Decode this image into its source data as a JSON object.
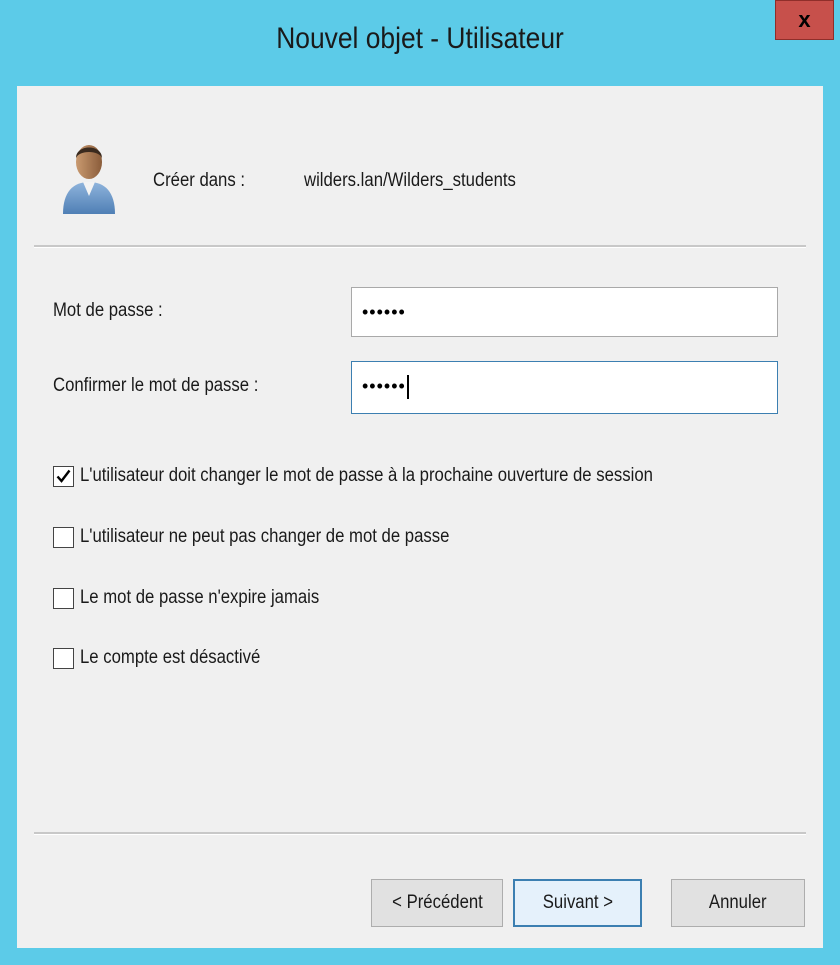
{
  "window": {
    "title": "Nouvel objet - Utilisateur",
    "close_label": "x"
  },
  "header": {
    "create_in_label": "Créer dans :",
    "create_in_path": "wilders.lan/Wilders_students",
    "icon": "user-icon"
  },
  "password": {
    "label": "Mot de passe :",
    "value": "••••••"
  },
  "confirm_password": {
    "label": "Confirmer le mot de passe :",
    "value": "••••••"
  },
  "options": [
    {
      "label": "L'utilisateur doit changer le mot de passe à la prochaine ouverture de session",
      "checked": true
    },
    {
      "label": "L'utilisateur ne peut pas changer de mot de passe",
      "checked": false
    },
    {
      "label": "Le mot de passe n'expire jamais",
      "checked": false
    },
    {
      "label": "Le compte est désactivé",
      "checked": false
    }
  ],
  "buttons": {
    "previous": "< Précédent",
    "next": "Suivant >",
    "cancel": "Annuler"
  },
  "colors": {
    "frame": "#5ccbe8",
    "close": "#c7504b",
    "client": "#f0f0f0"
  }
}
